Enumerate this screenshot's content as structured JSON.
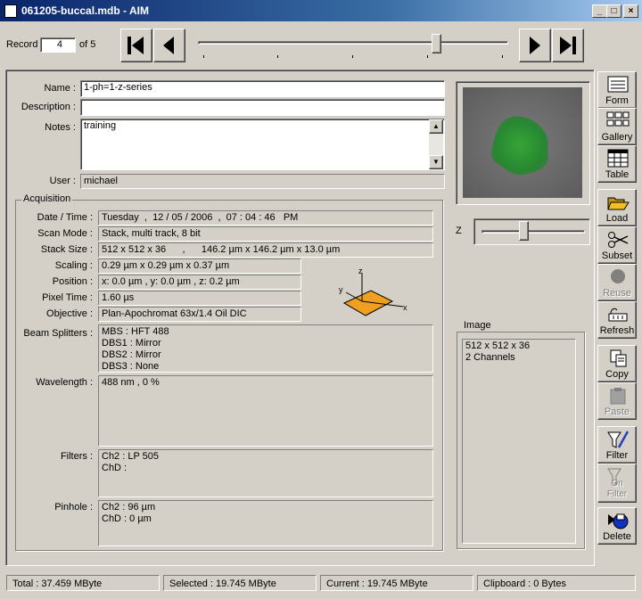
{
  "window": {
    "title": "061205-buccal.mdb - AIM",
    "min": "_",
    "max": "□",
    "close": "×"
  },
  "record": {
    "label": "Record",
    "value": "4",
    "of": "of 5"
  },
  "fields": {
    "name_label": "Name :",
    "name_value": "1-ph=1-z-series",
    "desc_label": "Description :",
    "desc_value": "",
    "notes_label": "Notes :",
    "notes_value": "training",
    "user_label": "User :",
    "user_value": "michael"
  },
  "acquisition": {
    "title": "Acquisition",
    "datetime_label": "Date / Time :",
    "datetime_value": "Tuesday  ,  12 / 05 / 2006  ,  07 : 04 : 46   PM",
    "scanmode_label": "Scan Mode :",
    "scanmode_value": "Stack, multi track, 8 bit",
    "stacksize_label": "Stack Size :",
    "stacksize_value": "512 x 512 x 36      ,      146.2 µm x 146.2 µm x 13.0 µm",
    "scaling_label": "Scaling :",
    "scaling_value": "0.29 µm x 0.29 µm x 0.37 µm",
    "position_label": "Position :",
    "position_value": "x: 0.0 µm , y: 0.0 µm , z: 0.2 µm",
    "pixeltime_label": "Pixel Time :",
    "pixeltime_value": "1.60 µs",
    "objective_label": "Objective :",
    "objective_value": "Plan-Apochromat 63x/1.4 Oil DIC",
    "beam_label": "Beam Splitters :",
    "beam_lines": [
      "MBS : HFT 488",
      "DBS1 : Mirror",
      "DBS2 : Mirror",
      "DBS3 : None"
    ],
    "wavelength_label": "Wavelength :",
    "wavelength_lines": [
      "488 nm , 0 %"
    ],
    "filters_label": "Filters :",
    "filters_lines": [
      "Ch2 : LP 505",
      "ChD :"
    ],
    "pinhole_label": "Pinhole :",
    "pinhole_lines": [
      "Ch2 : 96 µm",
      "ChD : 0 µm"
    ],
    "axes": {
      "z": "z",
      "y": "y",
      "x": "x"
    }
  },
  "z_label": "Z",
  "z_slider_fraction": 0.4,
  "record_slider_fraction": 0.77,
  "image_group": {
    "title": "Image",
    "lines": [
      "512 x 512 x 36",
      "2 Channels"
    ]
  },
  "toolbar": [
    {
      "label": "Form",
      "icon": "form-icon",
      "enabled": true
    },
    {
      "label": "Gallery",
      "icon": "gallery-icon",
      "enabled": true
    },
    {
      "label": "Table",
      "icon": "table-icon",
      "enabled": true
    },
    {
      "label": "Load",
      "icon": "folder-open-icon",
      "enabled": true
    },
    {
      "label": "Subset",
      "icon": "scissors-icon",
      "enabled": true
    },
    {
      "label": "Reuse",
      "icon": "reuse-icon",
      "enabled": false
    },
    {
      "label": "Refresh",
      "icon": "refresh-icon",
      "enabled": true
    },
    {
      "label": "Copy",
      "icon": "copy-icon",
      "enabled": true
    },
    {
      "label": "Paste",
      "icon": "paste-icon",
      "enabled": false
    },
    {
      "label": "Filter",
      "icon": "filter-icon",
      "enabled": true
    },
    {
      "label": "On\nFilter",
      "icon": "filter-on-icon",
      "enabled": false
    },
    {
      "label": "Delete",
      "icon": "delete-icon",
      "enabled": true
    }
  ],
  "status": {
    "total": "Total :  37.459 MByte",
    "selected": "Selected :  19.745 MByte",
    "current": "Current :  19.745 MByte",
    "clipboard": "Clipboard :  0 Bytes"
  },
  "colors": {
    "title_bar": "#0a246a",
    "face": "#d4d0c8",
    "folder": "#f0c020",
    "plane": "#f0a020"
  }
}
